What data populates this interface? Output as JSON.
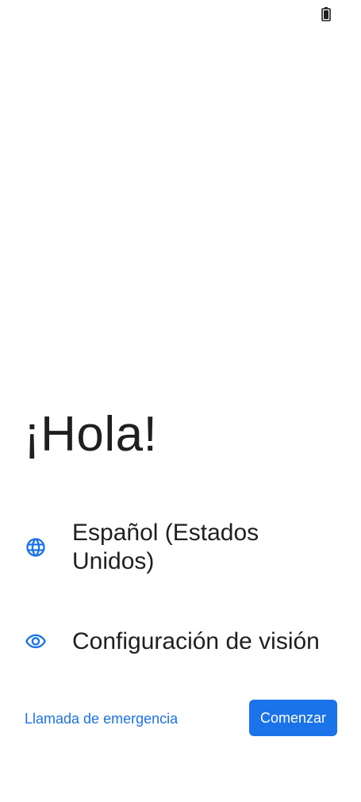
{
  "status_bar": {
    "battery_icon": "battery-icon"
  },
  "welcome": {
    "greeting": "¡Hola!"
  },
  "options": {
    "language": {
      "icon": "globe-icon",
      "label": "Español (Estados Unidos)"
    },
    "vision": {
      "icon": "eye-icon",
      "label": "Configuración de visión"
    }
  },
  "footer": {
    "emergency_label": "Llamada de emergencia",
    "start_label": "Comenzar"
  },
  "colors": {
    "accent": "#1a73e8",
    "text": "#1f1f1f",
    "background": "#ffffff"
  }
}
